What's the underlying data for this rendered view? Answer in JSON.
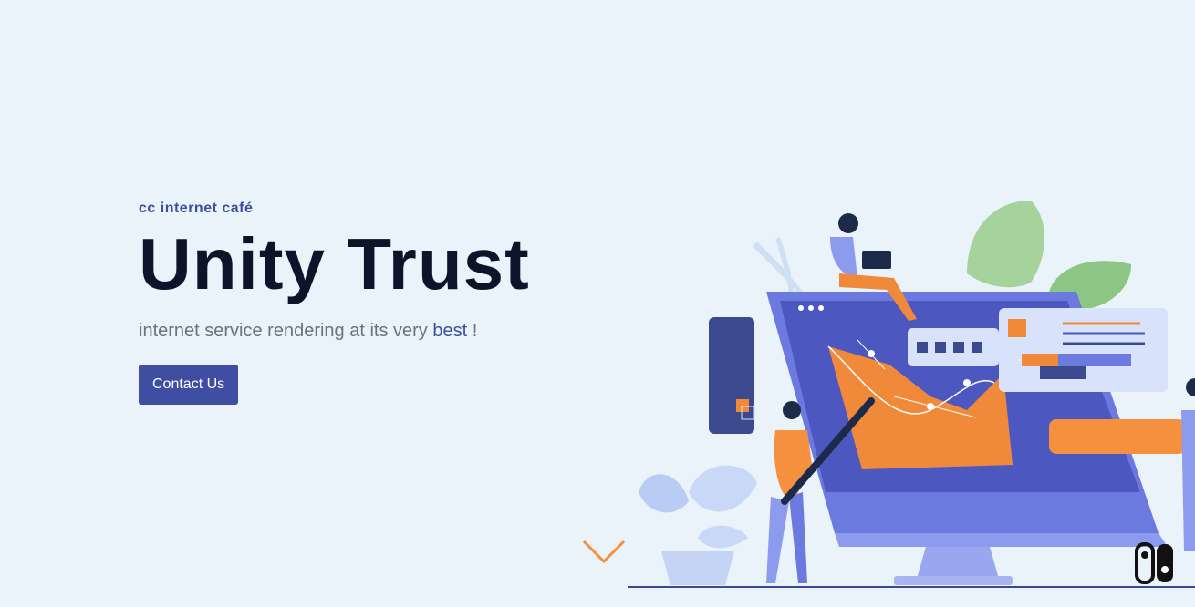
{
  "hero": {
    "eyebrow": "cc internet café",
    "title": "Unity Trust",
    "subtitle_before": "internet service rendering at its very ",
    "subtitle_highlight": "best",
    "subtitle_after": " !",
    "cta_label": "Contact Us"
  },
  "icons": {
    "scroll": "chevron-down-icon",
    "toggle": "switch-icon"
  },
  "colors": {
    "background": "#eaf2fa",
    "accent": "#3f4ea3",
    "title": "#0b1428",
    "muted_text": "#6b7280",
    "chevron": "#f5913e"
  }
}
